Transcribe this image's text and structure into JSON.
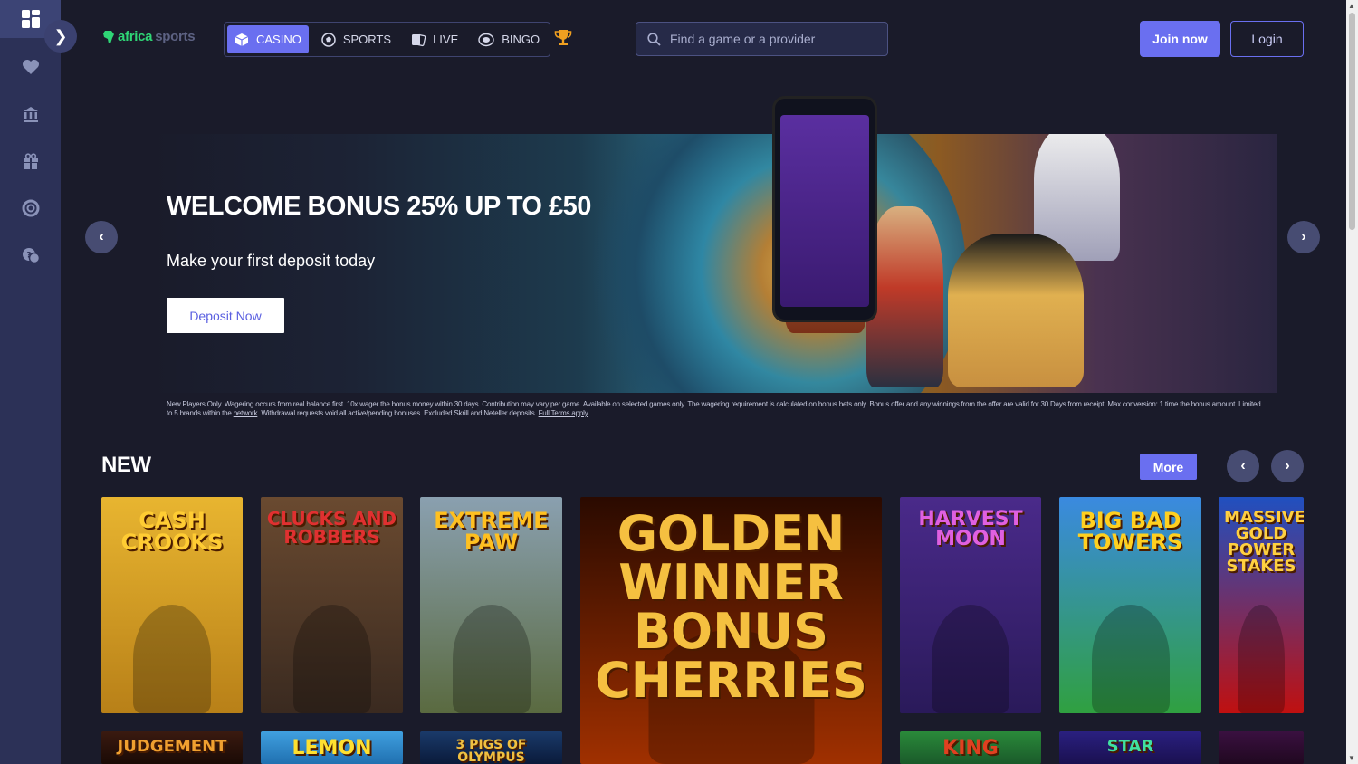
{
  "header": {
    "logo_part1": "africa",
    "logo_part2": "sports",
    "nav": [
      {
        "label": "CASINO",
        "icon": "cube-icon",
        "active": true
      },
      {
        "label": "SPORTS",
        "icon": "soccer-ball-icon",
        "active": false
      },
      {
        "label": "LIVE",
        "icon": "cards-icon",
        "active": false
      },
      {
        "label": "BINGO",
        "icon": "bingo-ball-icon",
        "active": false
      }
    ],
    "search_placeholder": "Find a game or a provider",
    "join_label": "Join now",
    "login_label": "Login"
  },
  "banner": {
    "title": "WELCOME BONUS 25% UP TO £50",
    "subtitle": "Make your first deposit today",
    "cta": "Deposit Now",
    "terms_part1": "New Players Only. Wagering occurs from real balance first. 10x wager the bonus money within 30 days. Contribution may vary per game. Available on selected games only. The wagering requirement is calculated on bonus bets only. Bonus offer and any winnings from the offer are valid for 30 Days from receipt. Max conversion: 1 time the bonus amount. Limited to 5 brands within the",
    "terms_link": "network",
    "terms_part2": ". Withdrawal requests void all active/pending bonuses. Excluded Skrill and Neteller deposits.",
    "terms_full_link": "Full Terms apply"
  },
  "new_section": {
    "title": "NEW",
    "more_label": "More",
    "games": [
      {
        "title": "CASH CROOKS",
        "color_top": "#e8b530",
        "color_bottom": "#b88018",
        "text_color": "#ffcc33"
      },
      {
        "title": "CLUCKS AND ROBBERS",
        "color_top": "#6a4a30",
        "color_bottom": "#3a2a20",
        "text_color": "#e03030"
      },
      {
        "title": "EXTREME PAW",
        "color_top": "#8aa0b0",
        "color_bottom": "#5a6a40",
        "text_color": "#ffc020"
      },
      {
        "title": "GOLDEN WINNER BONUS CHERRIES",
        "color_top": "#2a0a00",
        "color_bottom": "#a03000",
        "text_color": "#f5c040"
      },
      {
        "title": "HARVEST MOON",
        "color_top": "#4a2a8a",
        "color_bottom": "#2a1a5a",
        "text_color": "#e060e0"
      },
      {
        "title": "BIG BAD TOWERS",
        "color_top": "#3a8ae0",
        "color_bottom": "#30a040",
        "text_color": "#ffd020"
      },
      {
        "title": "MASSIVE GOLD POWER STAKES",
        "color_top": "#2050c0",
        "color_bottom": "#c01010",
        "text_color": "#ffd040"
      },
      {
        "title": "JUDGEMENT",
        "color_top": "#3a1a10",
        "color_bottom": "#1a0a05",
        "text_color": "#f0a030"
      },
      {
        "title": "LEMON",
        "color_top": "#40a0e0",
        "color_bottom": "#2070b0",
        "text_color": "#ffe030"
      },
      {
        "title": "3 PIGS OF OLYMPUS",
        "color_top": "#1a3a6a",
        "color_bottom": "#0a1a3a",
        "text_color": "#f0c040"
      },
      {
        "title": "KING",
        "color_top": "#2a8a3a",
        "color_bottom": "#1a5a2a",
        "text_color": "#e04020"
      },
      {
        "title": "STAR",
        "color_top": "#2a2080",
        "color_bottom": "#1a1050",
        "text_color": "#40e0a0"
      },
      {
        "title": "",
        "color_top": "#3a1040",
        "color_bottom": "#200820",
        "text_color": "#a040f0"
      }
    ]
  }
}
